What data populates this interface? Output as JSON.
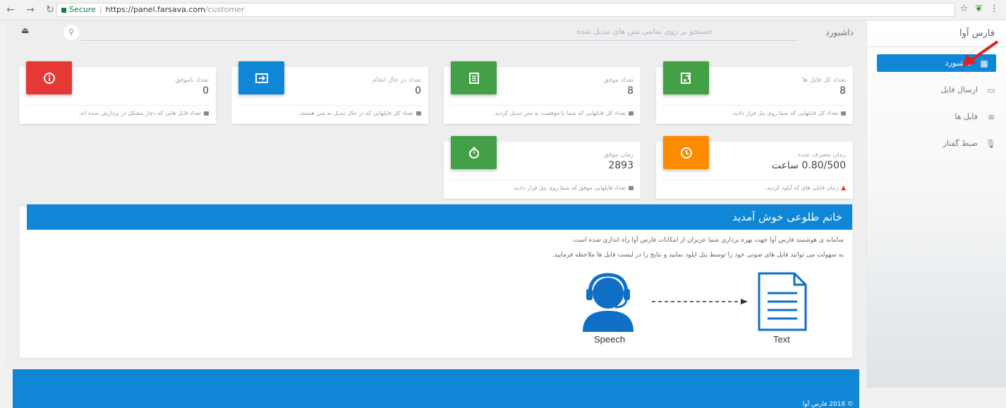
{
  "browser": {
    "secure_label": "Secure",
    "url_host": "https://panel.farsava.com",
    "url_path": "/customer"
  },
  "sidebar": {
    "brand": "فارس آوا",
    "items": [
      {
        "label": "داشبورد",
        "icon": "dashboard-icon",
        "active": true
      },
      {
        "label": "ارسال فایل",
        "icon": "upload-file-icon",
        "active": false
      },
      {
        "label": "فایل ها",
        "icon": "files-list-icon",
        "active": false
      },
      {
        "label": "ضبط گفتار",
        "icon": "microphone-icon",
        "active": false
      }
    ]
  },
  "topbar": {
    "breadcrumb": "داشبورد",
    "search_placeholder": "جستجو بر روی تمامی متن های تبدیل شده"
  },
  "cards": [
    {
      "title": "تعداد کل فایل ها",
      "value": "8",
      "footer": "تعداد کل فایلهایی که شما روی پنل قرار دادید.",
      "color": "#43a047",
      "icon": "file-audio-icon"
    },
    {
      "title": "تعداد موفق",
      "value": "8",
      "footer": "تعداد کل فایلهایی که شما با موفقیت به متن تبدیل کردید.",
      "color": "#43a047",
      "icon": "document-list-icon"
    },
    {
      "title": "تعداد در حال انجام",
      "value": "0",
      "footer": "تعداد کل فایلهایی که در حال تبدیل به متن هستند.",
      "color": "#0f87d6",
      "icon": "process-icon"
    },
    {
      "title": "تعداد ناموفق",
      "value": "0",
      "footer": "تعداد فایل هایی که دچار مشکل در پردازش شده اند.",
      "color": "#e53935",
      "icon": "info-icon"
    },
    {
      "title": "زمان مصرف شده",
      "value": "0.80/500 ساعت",
      "footer": "زمان فایلی های که آپلود کردید.",
      "color": "#fb8c00",
      "icon": "clock-icon"
    },
    {
      "title": "زمان موفق",
      "value": "2893",
      "footer": "تعداد فایلهایی موفق که شما روی پنل قرار دادید",
      "color": "#43a047",
      "icon": "stopwatch-icon"
    }
  ],
  "welcome": {
    "title": "خانم طلوعی خوش آمدید",
    "line1": "سامانه ی هوشمند فارس آوا جهت بهره برداری شما عزیزان از امکانات فارس آوا راه اندازی شده است.",
    "line2": "به سهولت می توانید فایل های صوتی خود را توسط پنل اپلود نمایید و نتایج را در لیست فایل ها ملاحظه فرمایید.",
    "speech_label": "Speech",
    "text_label": "Text"
  },
  "footer": {
    "copyright": "© 2018 فارس آوا"
  }
}
